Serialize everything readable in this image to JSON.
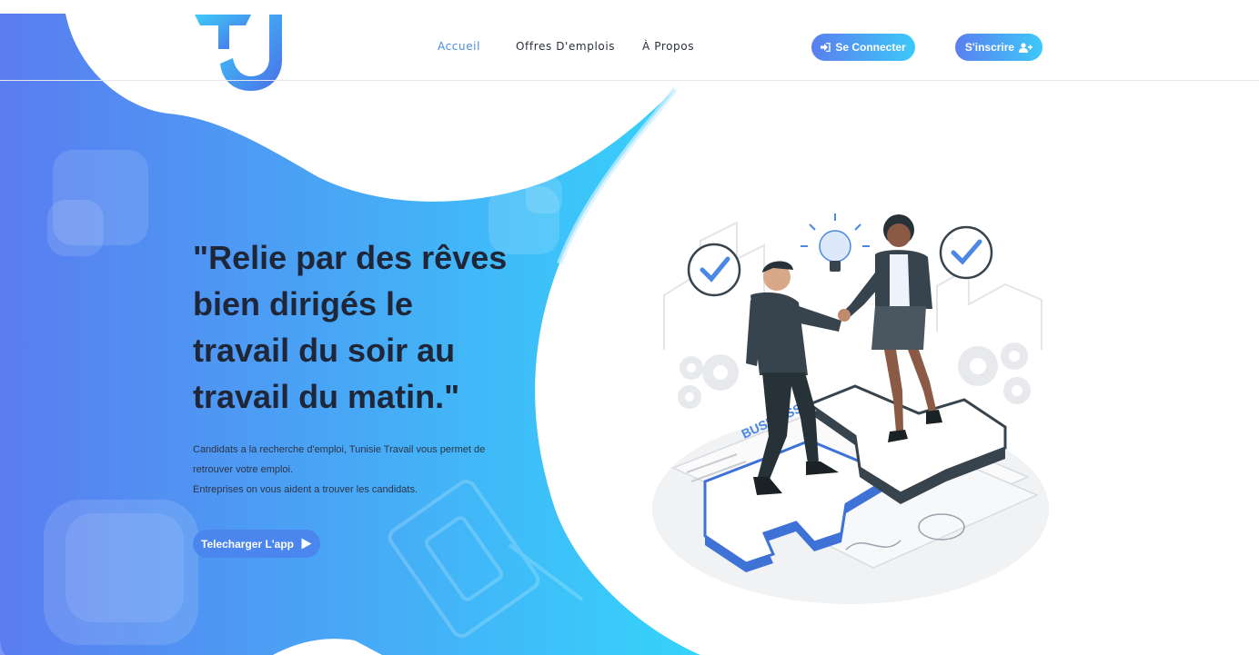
{
  "nav": {
    "home": "Accueil",
    "jobs": "Offres D'emplois",
    "about": "À Propos",
    "login": "Se Connecter",
    "register": "S'inscrire"
  },
  "hero": {
    "title_lines": [
      "\"Relie par des rêves",
      "bien dirigés le",
      "travail du soir au",
      "travail du matin.\""
    ],
    "desc_lines": [
      "Candidats a la recherche d'emploi, Tunisie Travail vous permet de",
      "retrouver votre emploi.",
      "Entreprises on vous aident a trouver les candidats."
    ],
    "download": "Telecharger L'app"
  },
  "illustration": {
    "puzzle_text": "BUSINESS"
  },
  "colors": {
    "gradient_start": "#5a7cf0",
    "gradient_end": "#35d4fb",
    "accent": "#4a8be0",
    "title": "#1f2637"
  },
  "icons": {
    "logo": "tj-logo",
    "login": "sign-in-icon",
    "register": "user-plus-icon",
    "download": "play-icon"
  }
}
